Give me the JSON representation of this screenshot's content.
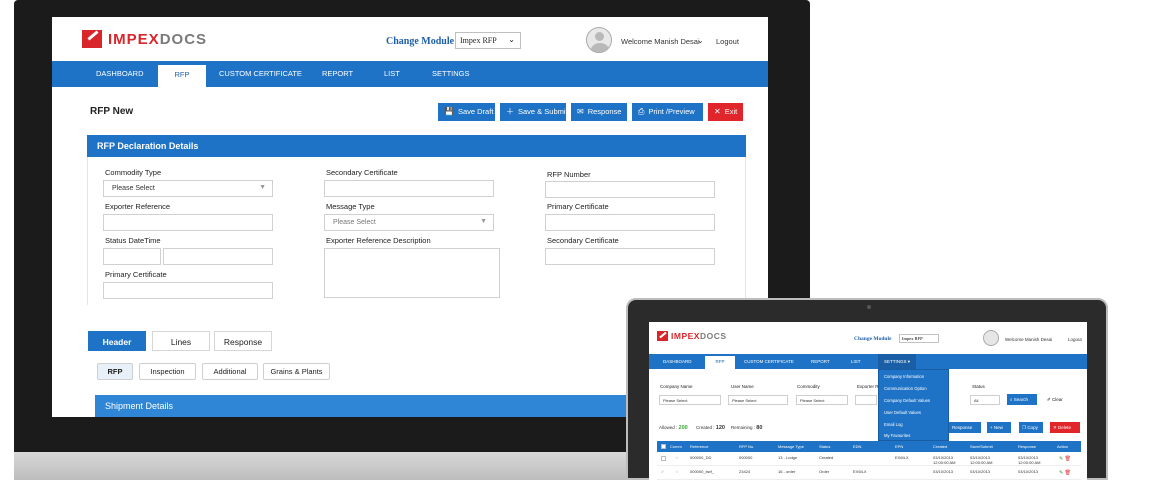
{
  "desktop": {
    "brand": {
      "part1": "IMPEX",
      "part2": "DOCS"
    },
    "header": {
      "change_module_label": "Change Module",
      "module_value": "Impex RFP",
      "welcome": "Welcome Manish Desai",
      "logout": "Logout"
    },
    "nav": [
      "DASHBOARD",
      "RFP",
      "CUSTOM CERTIFICATE",
      "REPORT",
      "LIST",
      "SETTINGS"
    ],
    "page_title": "RFP New",
    "actions": {
      "save_draft": "Save Draft",
      "save_submit": "Save & Submit",
      "response": "Response",
      "print_preview": "Print /Preview",
      "exit": "Exit"
    },
    "section_title": "RFP Declaration Details",
    "fields": {
      "commodity_type": "Commodity Type",
      "commodity_value": "Please Select",
      "exporter_reference": "Exporter Reference",
      "status_datetime": "Status DateTime",
      "primary_certificate": "Primary Certificate",
      "secondary_certificate": "Secondary Certificate",
      "message_type": "Message Type",
      "message_value": "Please Select",
      "exporter_ref_desc": "Exporter Reference Description",
      "rfp_number": "RFP Number",
      "primary_certificate_2": "Primary Certificate",
      "secondary_certificate_2": "Secondary Certificate"
    },
    "tabs": [
      "Header",
      "Lines",
      "Response"
    ],
    "subtabs": [
      "RFP",
      "Inspection",
      "Additional",
      "Grains & Plants"
    ],
    "shipment_title": "Shipment Details"
  },
  "laptop": {
    "header": {
      "change_module_label": "Change Module",
      "module_value": "Impex RFP",
      "welcome": "Welcome Manish Desai",
      "logout": "Logout"
    },
    "nav": [
      "DASHBOARD",
      "RFP",
      "CUSTOM CERTIFICATE",
      "REPORT",
      "LIST",
      "SETTINGS"
    ],
    "settings_menu": [
      "Company Information",
      "Communication Option",
      "Company Default Values",
      "User Default Values",
      "Email Log",
      "My Favourites"
    ],
    "filters": {
      "company_name": "Company Name",
      "user_name": "User Name",
      "commodity": "Commodity",
      "exporter": "Exporter R",
      "status": "Status",
      "please_select": "Please Select",
      "status_value": "All",
      "search": "Search",
      "clear": "Clear"
    },
    "counts": {
      "allowed_label": "Allowed :",
      "allowed_value": "200",
      "created_label": "Created :",
      "created_value": "120",
      "remaining_label": "Remaining :",
      "remaining_value": "80"
    },
    "buttons": {
      "response": "Response",
      "new": "New",
      "copy": "Copy",
      "delete": "Delete"
    },
    "columns": [
      "Comm",
      "Reference",
      "RFP No.",
      "Message Type",
      "Status",
      "EDN",
      "EPN",
      "Created",
      "Save/Submit",
      "Response",
      "Action"
    ],
    "rows": [
      {
        "reference": "000000_DD",
        "rfp_no": "000000",
        "message_type": "13 - Lodge",
        "status": "Created",
        "edn": "",
        "epn": "EX6ILX",
        "created": "03/10/2013",
        "created_time": "12:00:00 AM",
        "save_submit": "03/10/2013",
        "save_time": "12:00:00 AM",
        "response": "03/10/2013",
        "response_time": "12:00:00 AM"
      },
      {
        "reference": "000000_bwf_",
        "rfp_no": "23424",
        "message_type": "16 - order",
        "status": "Order",
        "edn": "EX6ILX",
        "epn": "",
        "created": "03/10/2013",
        "created_time": "",
        "save_submit": "03/10/2013",
        "save_time": "",
        "response": "03/10/2013",
        "response_time": ""
      }
    ]
  },
  "colors": {
    "primary": "#1f73c6",
    "danger": "#e0262b",
    "brand_red": "#d9262b",
    "brand_grey": "#7a7a7a"
  }
}
